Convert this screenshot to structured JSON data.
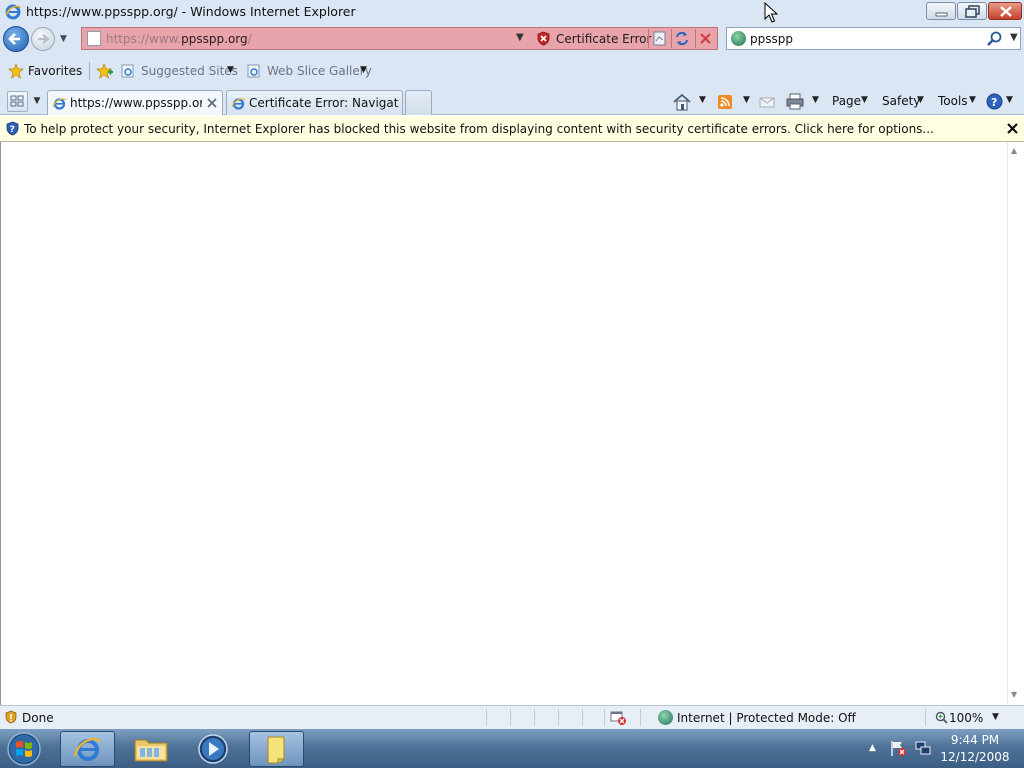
{
  "window": {
    "title": "https://www.ppsspp.org/ - Windows Internet Explorer"
  },
  "address_bar": {
    "url_prefix": "https://www.",
    "url_domain": "ppsspp.org",
    "url_suffix": "/",
    "certificate_error_label": "Certificate Error",
    "background_color": "#e8a3ab"
  },
  "search": {
    "value": "ppsspp"
  },
  "favorites_bar": {
    "favorites_label": "Favorites",
    "items": [
      {
        "label": "Suggested Sites"
      },
      {
        "label": "Web Slice Gallery"
      }
    ]
  },
  "tabs": [
    {
      "label": "https://www.ppsspp.or...",
      "active": true
    },
    {
      "label": "Certificate Error: Navigatio...",
      "active": false
    }
  ],
  "command_bar": {
    "page_label": "Page",
    "safety_label": "Safety",
    "tools_label": "Tools"
  },
  "info_bar": {
    "text": "To help protect your security, Internet Explorer has blocked this website from displaying content with security certificate errors. Click here for options...",
    "background_color": "#ffffe1"
  },
  "status_bar": {
    "status_text": "Done",
    "zone_text": "Internet | Protected Mode: Off",
    "zoom_text": "100%"
  },
  "taskbar": {
    "clock_time": "9:44 PM",
    "clock_date": "12/12/2008",
    "buttons": [
      {
        "name": "internet-explorer",
        "icon": "ie-icon"
      },
      {
        "name": "windows-explorer",
        "icon": "folder-icon"
      },
      {
        "name": "media-player",
        "icon": "media-player-icon"
      },
      {
        "name": "sticky-notes",
        "icon": "notes-icon"
      }
    ]
  },
  "colors": {
    "chrome": "#dbe6f4",
    "taskbar": "#4e7297",
    "error_red": "#c62828"
  }
}
